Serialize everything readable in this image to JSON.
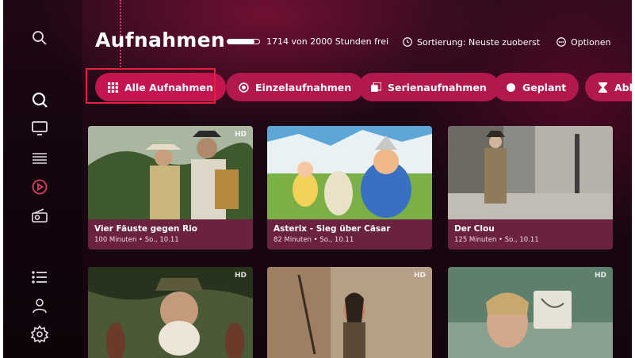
{
  "header": {
    "title": "Aufnahmen",
    "storage_text": "1714 von 2000 Stunden frei",
    "storage_fraction": 0.857,
    "sort_label": "Sortierung: Neuste zuoberst",
    "options_label": "Optionen"
  },
  "sidebar": {
    "items": [
      {
        "icon": "search-icon"
      },
      {
        "icon": "search-icon"
      },
      {
        "icon": "tv-icon"
      },
      {
        "icon": "guide-icon"
      },
      {
        "icon": "play-circle-icon",
        "active": true
      },
      {
        "icon": "radio-icon"
      },
      {
        "icon": "list-icon"
      },
      {
        "icon": "profile-icon"
      },
      {
        "icon": "settings-icon"
      }
    ]
  },
  "filters": [
    {
      "label": "Alle Aufnahmen",
      "icon": "grid-icon",
      "selected": true
    },
    {
      "label": "Einzelaufnahmen",
      "icon": "radio-dot-icon"
    },
    {
      "label": "Serienaufnahmen",
      "icon": "stack-icon"
    },
    {
      "label": "Geplant",
      "icon": "dot-icon"
    },
    {
      "label": "Ablau",
      "icon": "hourglass-icon"
    }
  ],
  "recordings": [
    {
      "title": "Vier Fäuste gegen Rio",
      "meta": "100 Minuten • So., 10.11",
      "channel": "HD"
    },
    {
      "title": "Asterix - Sieg über Cäsar",
      "meta": "82 Minuten • So., 10.11",
      "channel": ""
    },
    {
      "title": "Der Clou",
      "meta": "125 Minuten • So., 10.11",
      "channel": ""
    }
  ],
  "recordings_row2": [
    {
      "channel": "HD"
    },
    {
      "channel": "HD"
    },
    {
      "channel": "HD"
    }
  ],
  "colors": {
    "accent": "#e0306a",
    "chip": "#b2184c",
    "focus": "#e6203c"
  }
}
